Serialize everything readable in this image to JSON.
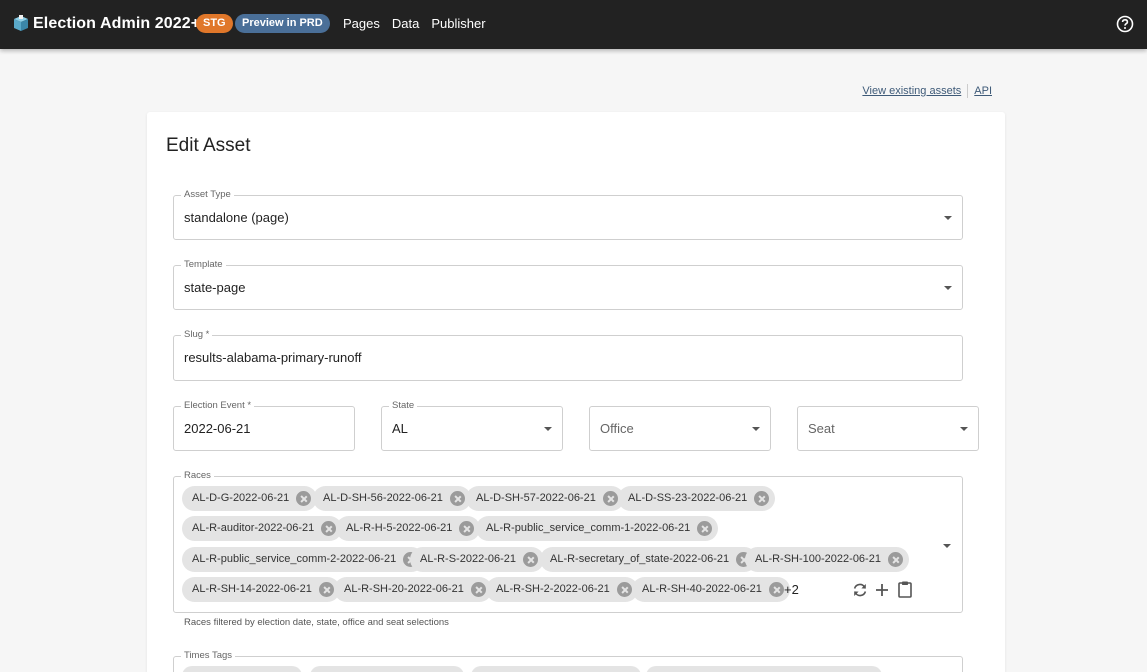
{
  "header": {
    "app_title": "Election Admin 2022+",
    "badge_env": "STG",
    "badge_preview": "Preview in PRD",
    "nav": [
      "Pages",
      "Data",
      "Publisher"
    ],
    "help_icon": "help-circle-icon"
  },
  "links": {
    "view_assets": "View existing assets",
    "api": "API"
  },
  "card": {
    "title": "Edit Asset"
  },
  "form": {
    "asset_type": {
      "label": "Asset Type",
      "value": "standalone (page)"
    },
    "template": {
      "label": "Template",
      "value": "state-page"
    },
    "slug": {
      "label": "Slug *",
      "value": "results-alabama-primary-runoff"
    },
    "election_event": {
      "label": "Election Event *",
      "value": "2022-06-21"
    },
    "state": {
      "label": "State",
      "value": "AL"
    },
    "office": {
      "placeholder": "Office"
    },
    "seat": {
      "placeholder": "Seat"
    },
    "races": {
      "label": "Races",
      "chips": [
        "AL-D-G-2022-06-21",
        "AL-D-SH-56-2022-06-21",
        "AL-D-SH-57-2022-06-21",
        "AL-D-SS-23-2022-06-21",
        "AL-R-auditor-2022-06-21",
        "AL-R-H-5-2022-06-21",
        "AL-R-public_service_comm-1-2022-06-21",
        "AL-R-public_service_comm-2-2022-06-21",
        "AL-R-S-2022-06-21",
        "AL-R-secretary_of_state-2022-06-21",
        "AL-R-SH-100-2022-06-21",
        "AL-R-SH-14-2022-06-21",
        "AL-R-SH-20-2022-06-21",
        "AL-R-SH-2-2022-06-21",
        "AL-R-SH-40-2022-06-21"
      ],
      "more": "+2",
      "helper": "Races filtered by election date, state, office and seat selections"
    },
    "times_tags": {
      "label": "Times Tags"
    }
  }
}
